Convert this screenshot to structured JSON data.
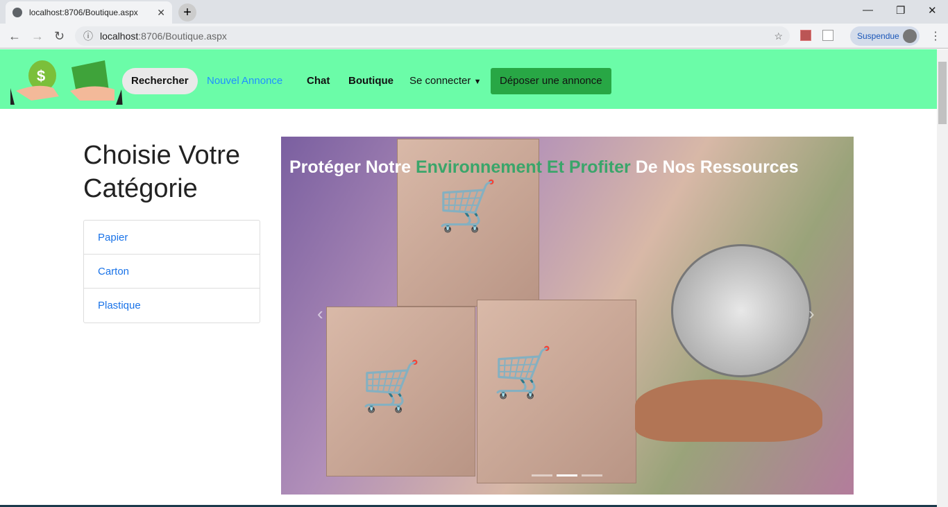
{
  "browser": {
    "tab_title": "localhost:8706/Boutique.aspx",
    "url_host": "localhost",
    "url_path": ":8706/Boutique.aspx",
    "profile": "Suspendue"
  },
  "nav": {
    "search": "Rechercher",
    "nouvel": "Nouvel Annonce",
    "chat": "Chat",
    "boutique": "Boutique",
    "connect": "Se connecter",
    "deposer": "Déposer une annonce"
  },
  "sidebar": {
    "title": "Choisie Votre Catégorie",
    "categories": [
      "Papier",
      "Carton",
      "Plastique"
    ]
  },
  "carousel": {
    "caption_part1": "Protéger Notre ",
    "caption_part2": "Environnement Et Profiter",
    "caption_part3": " De Nos Ressources",
    "slides": 3,
    "active_slide": 2
  }
}
